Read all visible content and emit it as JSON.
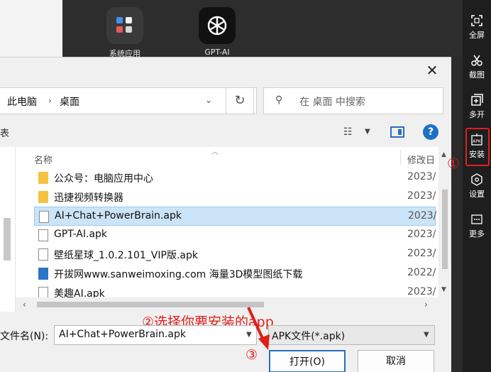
{
  "desktop": {
    "icons": [
      {
        "label": "系统应用"
      },
      {
        "label": "GPT-AI"
      }
    ]
  },
  "sidebar": {
    "items": [
      {
        "label": "全屏",
        "icon": "fullscreen-icon"
      },
      {
        "label": "截图",
        "icon": "scissors-icon"
      },
      {
        "label": "多开",
        "icon": "multi-open-icon"
      },
      {
        "label": "安装",
        "icon": "apk-install-icon"
      },
      {
        "label": "设置",
        "icon": "settings-hexagon-icon"
      },
      {
        "label": "更多",
        "icon": "more-icon"
      }
    ]
  },
  "dialog": {
    "close_glyph": "✕",
    "breadcrumb": [
      "此电脑",
      "桌面"
    ],
    "search_placeholder": "在 桌面 中搜索",
    "toolbar_left_text": "表",
    "columns": {
      "name": "名称",
      "modified": "修改日"
    },
    "files": [
      {
        "name": "公众号：电脑应用中心",
        "date": "2023/",
        "type": "folder",
        "selected": false
      },
      {
        "name": "迅捷视频转换器",
        "date": "2023/",
        "type": "folder",
        "selected": false
      },
      {
        "name": "AI+Chat+PowerBrain.apk",
        "date": "2023/",
        "type": "doc",
        "selected": true
      },
      {
        "name": "GPT-AI.apk",
        "date": "2023/",
        "type": "doc",
        "selected": false
      },
      {
        "name": "壁纸星球_1.0.2.101_VIP版.apk",
        "date": "2023/",
        "type": "doc",
        "selected": false
      },
      {
        "name": "开拔网www.sanweimoxing.com 海量3D模型图纸下载",
        "date": "2022/",
        "type": "web",
        "selected": false
      },
      {
        "name": "美趣AI.apk",
        "date": "2023/",
        "type": "doc",
        "selected": false
      }
    ],
    "filename_label": "文件名(N):",
    "filename_value": "AI+Chat+PowerBrain.apk",
    "filetype_value": "APK文件(*.apk)",
    "open_label": "打开(O)",
    "cancel_label": "取消"
  },
  "annotations": {
    "step1": "①",
    "step2": "②选择你要安装的app",
    "step3": "③"
  },
  "colors": {
    "annotation_red": "#e0201a",
    "selection_blue": "#cce4f7",
    "accent_blue": "#2a6ebd"
  }
}
